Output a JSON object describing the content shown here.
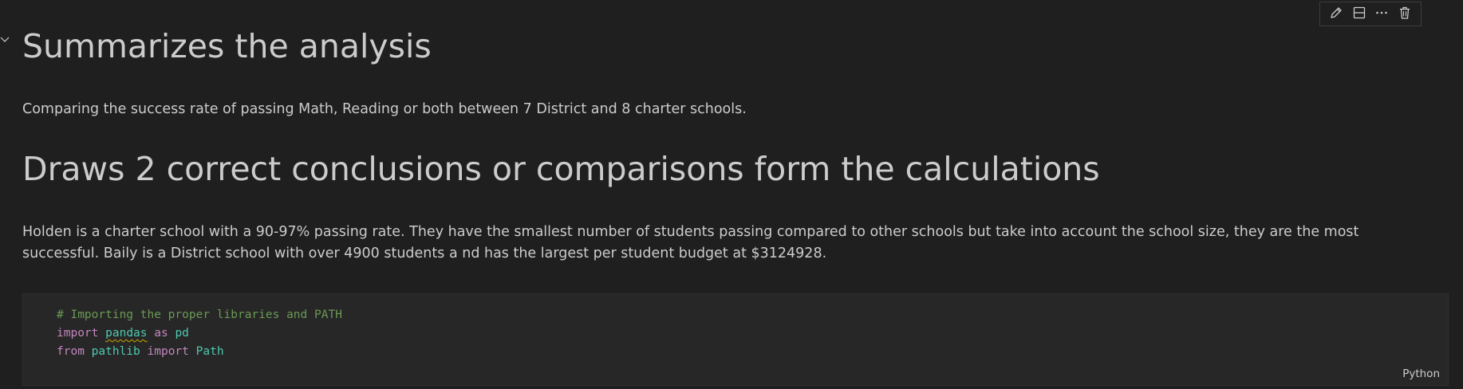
{
  "markdown_cell": {
    "heading_1": "Summarizes the analysis",
    "paragraph_1": "Comparing the success rate of passing Math, Reading or both between 7 District and 8 charter schools.",
    "heading_2": "Draws 2 correct conclusions or comparisons form the calculations",
    "paragraph_2": "Holden is a charter school with a 90-97% passing rate. They have the smallest number of students passing compared to other schools but take into account the school size, they are the most successful. Baily is a District school with over 4900 students a nd has the largest per student budget at $3124928."
  },
  "cell_toolbar": {
    "icons": [
      "pencil-icon",
      "split-cell-icon",
      "more-icon",
      "trash-icon"
    ]
  },
  "code_cell": {
    "line_1_comment": "# Importing the proper libraries and PATH",
    "line_2": {
      "kw_import": "import",
      "module": "pandas",
      "kw_as": "as",
      "alias": "pd"
    },
    "line_3": {
      "kw_from": "from",
      "module": "pathlib",
      "kw_import": "import",
      "name": "Path"
    },
    "language": "Python"
  },
  "colors": {
    "background": "#1f1f1f",
    "text": "#cccccc",
    "code_background": "#272727",
    "comment": "#6a9955",
    "keyword": "#c586c0",
    "module": "#4ec9b0"
  }
}
